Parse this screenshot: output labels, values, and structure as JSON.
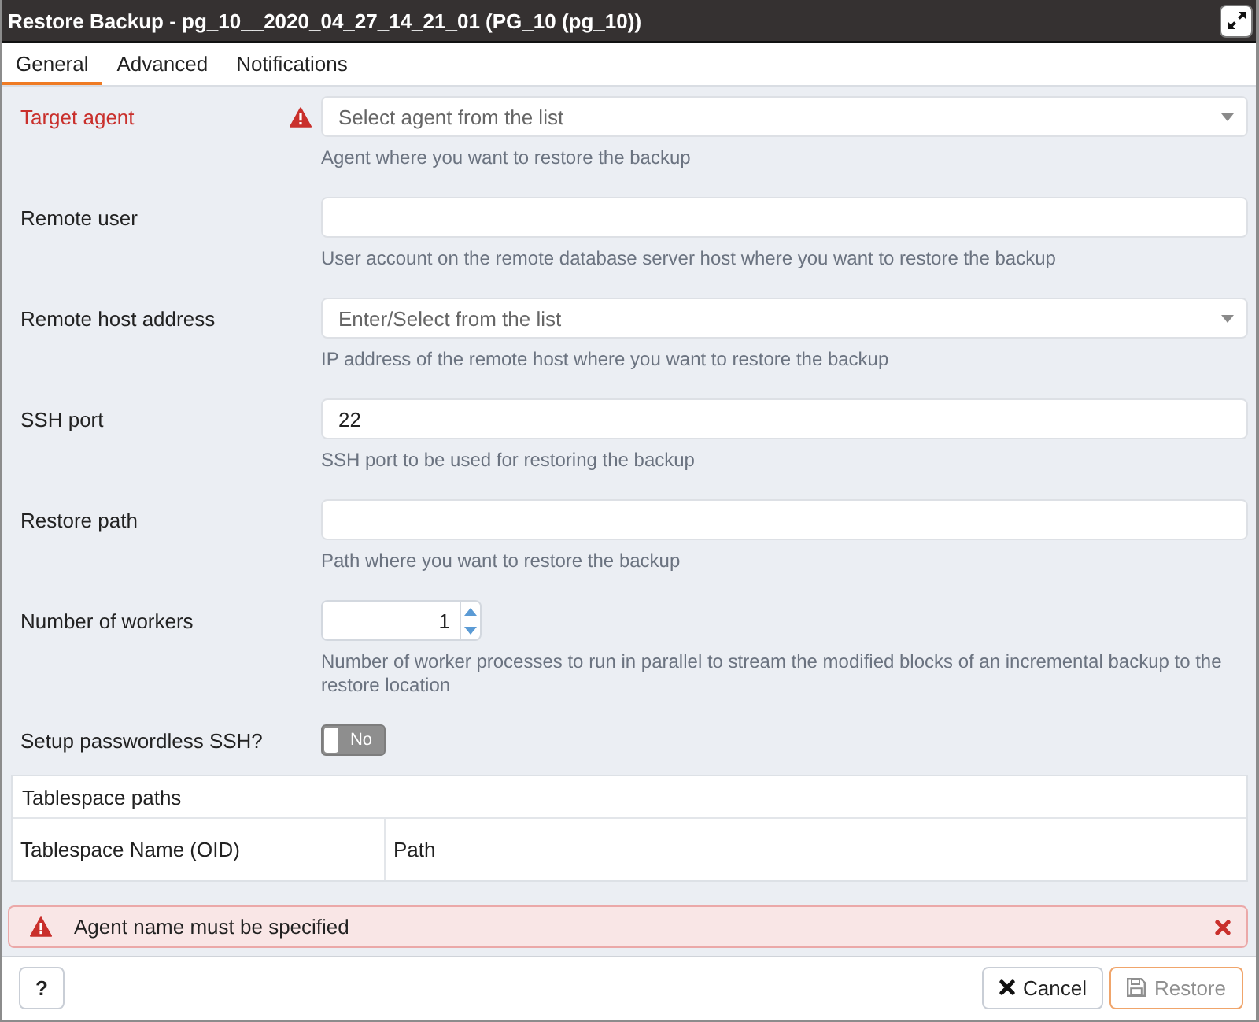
{
  "window": {
    "title": "Restore Backup - pg_10__2020_04_27_14_21_01 (PG_10 (pg_10))"
  },
  "tabs": [
    {
      "label": "General",
      "selected": true
    },
    {
      "label": "Advanced",
      "selected": false
    },
    {
      "label": "Notifications",
      "selected": false
    }
  ],
  "fields": [
    {
      "kind": "select",
      "label": "Target agent",
      "invalid": true,
      "placeholder": "Select agent from the list",
      "help": "Agent where you want to restore the backup"
    },
    {
      "kind": "text",
      "label": "Remote user",
      "invalid": false,
      "help": "User account on the remote database server host where you want to restore the backup"
    },
    {
      "kind": "select",
      "label": "Remote host address",
      "invalid": false,
      "placeholder": "Enter/Select from the list",
      "help": "IP address of the remote host where you want to restore the backup"
    },
    {
      "kind": "text",
      "label": "SSH port",
      "invalid": false,
      "value": "22",
      "help": "SSH port to be used for restoring the backup"
    },
    {
      "kind": "text",
      "label": "Restore path",
      "invalid": false,
      "help": "Path where you want to restore the backup"
    },
    {
      "kind": "number",
      "label": "Number of workers",
      "invalid": false,
      "value": "1",
      "help": "Number of worker processes to run in parallel to stream the modified blocks of an incremental backup to the restore location"
    },
    {
      "kind": "switch",
      "label": "Setup passwordless SSH?",
      "invalid": false,
      "on": false,
      "switch_text": "No"
    }
  ],
  "tablespace": {
    "title": "Tablespace paths",
    "columns": [
      "Tablespace Name (OID)",
      "Path"
    ]
  },
  "alert": {
    "message": "Agent name must be specified"
  },
  "footer": {
    "help_button": "?",
    "buttons": [
      {
        "kind": "cancel",
        "label": "Cancel",
        "primary": false,
        "disabled": false
      },
      {
        "kind": "restore",
        "label": "Restore",
        "primary": true,
        "disabled": true
      }
    ]
  }
}
